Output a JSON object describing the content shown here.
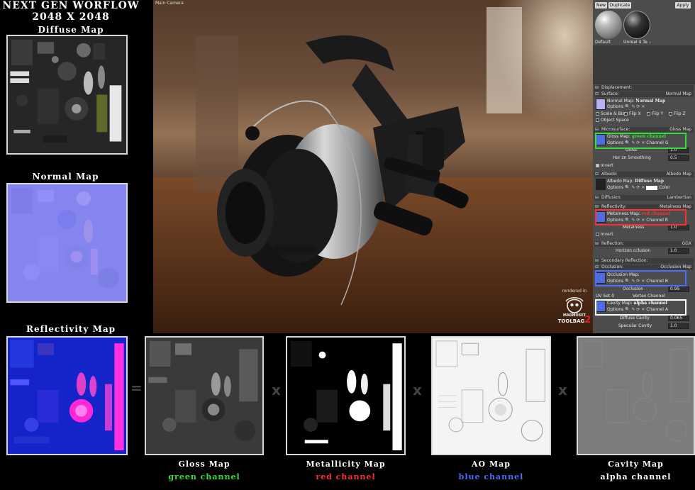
{
  "header": {
    "title": "NEXT GEN WORFLOW",
    "resolution": "2048 X 2048"
  },
  "left_maps": {
    "diffuse_label": "Diffuse Map",
    "normal_label": "Normal Map",
    "reflectivity_label": "Reflectivity Map"
  },
  "viewport": {
    "camera_label": "Main Camera",
    "rendered_in": "rendered in",
    "logo_line1": "MARMOSET",
    "logo_line2": "TOOLBAG",
    "logo_num": "2"
  },
  "panel": {
    "buttons": {
      "new": "New",
      "duplicate": "Duplicate",
      "apply": "Apply"
    },
    "materials": [
      "Default",
      "Unreal 4 Te..."
    ],
    "displacement": "Displacement:",
    "surface": {
      "label": "Surface:",
      "value": "Normal Map"
    },
    "normal_map_label": "Normal Map:",
    "normal_map_value": "Normal Map",
    "options": "Options",
    "scale_bias": "Scale & Bias",
    "flip_x": "Flip X",
    "flip_y": "Flip Y",
    "flip_z": "Flip Z",
    "object_space": "Object Space",
    "microsurface": {
      "label": "Microsurface:",
      "value": "Gloss Map"
    },
    "gloss_map_label": "Gloss Map:",
    "gloss_map_value": "green channel",
    "channel": "Channel",
    "channel_g": "G",
    "gloss": "Gloss",
    "gloss_val": "1.0",
    "horizon_smoothing": "Hor   zn Smoothing",
    "horizon_smoothing_val": "0.5",
    "invert": "Invert",
    "albedo": {
      "label": "Albedo:",
      "value": "Albedo Map"
    },
    "albedo_map_label": "Albedo Map:",
    "albedo_map_value": "Diffuse Map",
    "color": "Color",
    "diffusion": {
      "label": "Diffusion:",
      "value": "Lambertian"
    },
    "reflectivity": {
      "label": "Reflectivity:",
      "value": "Metalness Map"
    },
    "metalness_map_label": "Metalness Map:",
    "metalness_map_value": "red channel",
    "channel_r": "R",
    "metalness": "Metalness",
    "metalness_val": "1.0",
    "invert2": "Invert",
    "reflection": {
      "label": "Reflection:",
      "value": "GGX"
    },
    "horizon_occlusion": "Horizon   cclusion",
    "horizon_occlusion_val": "1.0",
    "secondary_reflection": "Secondary Reflection:",
    "occlusion": {
      "label": "Occlusion:",
      "value": "Occlusion Map"
    },
    "occlusion_map_label": "Occlusion Map:",
    "channel_b": "B",
    "occlusion_lbl": "Occlusion",
    "occlusion_val": "0.95",
    "uv_set": "UV Set",
    "uv_set_val": "0",
    "vertex_channel": "Vertex Channel",
    "cavity_map_label": "Cavity Map:",
    "cavity_map_value": "alpha channel",
    "channel_a": "A",
    "diffuse_cavity": "Diffuse Cavity",
    "diffuse_cavity_val": "0.065",
    "specular_cavity": "Specular Cavity",
    "specular_cavity_val": "1.0"
  },
  "bottom": {
    "gloss_label": "Gloss Map",
    "gloss_channel": "green channel",
    "metal_label": "Metallicity Map",
    "metal_channel": "red channel",
    "ao_label": "AO Map",
    "ao_channel": "blue channel",
    "cavity_label": "Cavity Map",
    "cavity_channel": "alpha channel",
    "equals": "=",
    "times": "x"
  },
  "colors": {
    "green_channel": "#35e035",
    "red_channel": "#ff3030",
    "blue_channel": "#4d6dff",
    "alpha_channel": "#ffffff"
  }
}
